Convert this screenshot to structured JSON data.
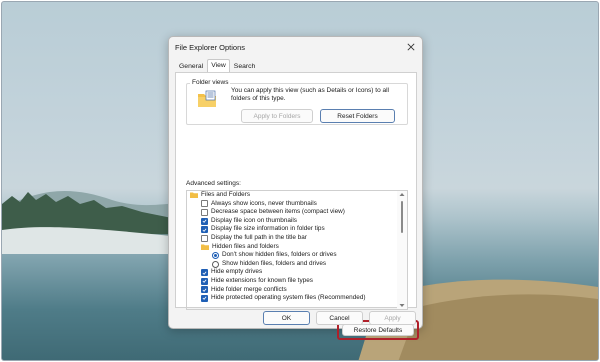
{
  "dialog": {
    "title": "File Explorer Options",
    "tabs": [
      {
        "label": "General",
        "active": false
      },
      {
        "label": "View",
        "active": true
      },
      {
        "label": "Search",
        "active": false
      }
    ]
  },
  "folder_views": {
    "legend": "Folder views",
    "description": "You can apply this view (such as Details or Icons) to all folders of this type.",
    "apply_label": "Apply to Folders",
    "reset_label": "Reset Folders"
  },
  "advanced": {
    "label": "Advanced settings:",
    "items": [
      {
        "type": "folder",
        "label": "Files and Folders",
        "indent": 0
      },
      {
        "type": "checkbox",
        "label": "Always show icons, never thumbnails",
        "checked": false,
        "indent": 1
      },
      {
        "type": "checkbox",
        "label": "Decrease space between items (compact view)",
        "checked": false,
        "indent": 1
      },
      {
        "type": "checkbox",
        "label": "Display file icon on thumbnails",
        "checked": true,
        "indent": 1
      },
      {
        "type": "checkbox",
        "label": "Display file size information in folder tips",
        "checked": true,
        "indent": 1
      },
      {
        "type": "checkbox",
        "label": "Display the full path in the title bar",
        "checked": false,
        "indent": 1
      },
      {
        "type": "folder",
        "label": "Hidden files and folders",
        "indent": 1
      },
      {
        "type": "radio",
        "label": "Don't show hidden files, folders or drives",
        "checked": true,
        "indent": 2
      },
      {
        "type": "radio",
        "label": "Show hidden files, folders and drives",
        "checked": false,
        "indent": 2
      },
      {
        "type": "checkbox",
        "label": "Hide empty drives",
        "checked": true,
        "indent": 1
      },
      {
        "type": "checkbox",
        "label": "Hide extensions for known file types",
        "checked": true,
        "indent": 1
      },
      {
        "type": "checkbox",
        "label": "Hide folder merge conflicts",
        "checked": true,
        "indent": 1
      },
      {
        "type": "checkbox",
        "label": "Hide protected operating system files (Recommended)",
        "checked": true,
        "indent": 1
      }
    ]
  },
  "buttons": {
    "restore_defaults": "Restore Defaults",
    "ok": "OK",
    "cancel": "Cancel",
    "apply": "Apply"
  },
  "colors": {
    "accent": "#1f5fb5",
    "highlight": "#b0202a"
  },
  "icons": {
    "close": "close-icon",
    "folder": "folder-icon"
  }
}
